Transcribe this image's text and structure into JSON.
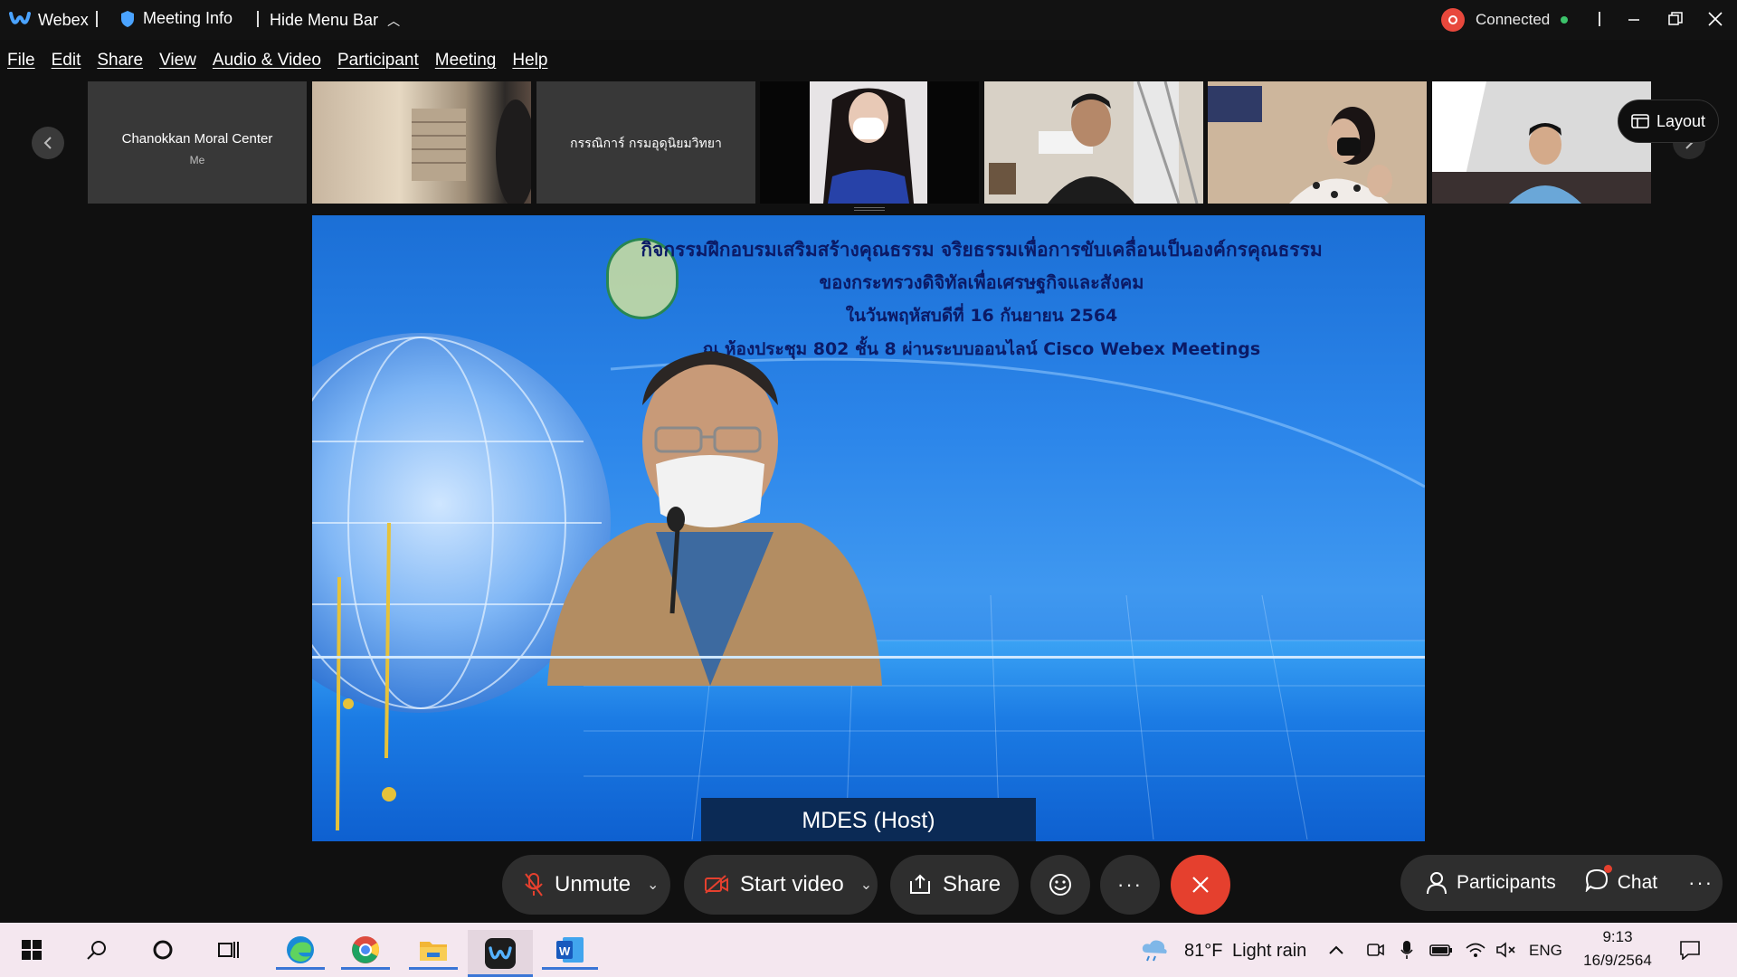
{
  "titlebar": {
    "app_name": "Webex",
    "meeting_info": "Meeting Info",
    "hide_menu": "Hide Menu Bar",
    "status": "Connected"
  },
  "menu": [
    "File",
    "Edit",
    "Share",
    "View",
    "Audio & Video",
    "Participant",
    "Meeting",
    "Help"
  ],
  "filmstrip": {
    "tiles": [
      {
        "name": "Chanokkan Moral Center",
        "sub": "Me"
      },
      {
        "name": ""
      },
      {
        "name": "กรรณิการ์ กรมอุดุนิยมวิทยา"
      },
      {
        "name": ""
      },
      {
        "name": ""
      },
      {
        "name": ""
      },
      {
        "name": ""
      }
    ],
    "layout_label": "Layout"
  },
  "stage": {
    "slide_lines": [
      "กิจกรรมฝึกอบรมเสริมสร้างคุณธรรม จริยธรรมเพื่อการขับเคลื่อนเป็นองค์กรคุณธรรม",
      "ของกระทรวงดิจิทัลเพื่อเศรษฐกิจและสังคม",
      "ในวันพฤหัสบดีที่ 16 กันยายน 2564",
      "ณ ห้องประชุม 802 ชั้น 8 ผ่านระบบออนไลน์ Cisco Webex Meetings"
    ],
    "host_label": "MDES (Host)"
  },
  "controls": {
    "unmute": "Unmute",
    "start_video": "Start video",
    "share": "Share",
    "participants": "Participants",
    "chat": "Chat"
  },
  "taskbar": {
    "weather_temp": "81°F",
    "weather_text": "Light rain",
    "lang": "ENG",
    "time": "9:13",
    "date": "16/9/2564"
  },
  "colors": {
    "end_call": "#e5402e",
    "connected_dot": "#3cc36b",
    "stage_blue": "#2c86ea",
    "taskbar_bg": "#f4e7ef"
  }
}
